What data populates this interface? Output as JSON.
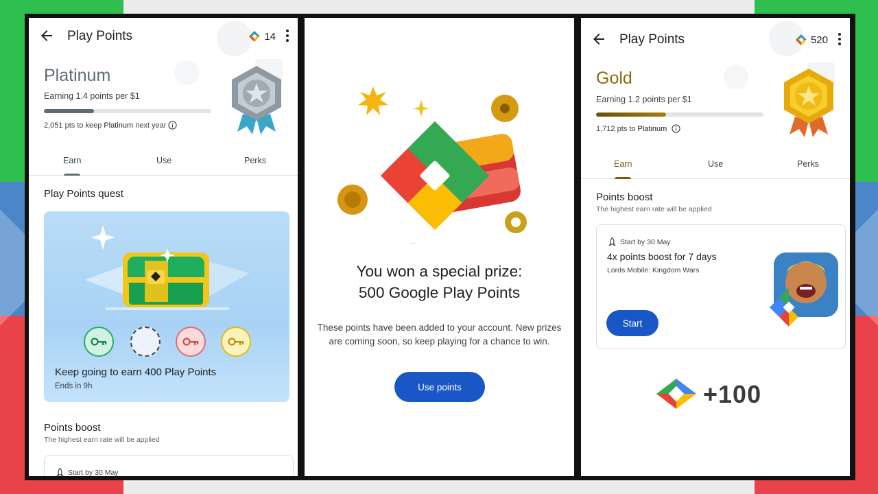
{
  "left": {
    "title": "Play Points",
    "points": "14",
    "tier": "Platinum",
    "earning": "Earning 1.4 points per $1",
    "progress_fraction": 0.3,
    "keep_prefix": "2,051 pts to keep ",
    "keep_tier": "Platinum",
    "keep_suffix": " next year",
    "tabs": [
      "Earn",
      "Use",
      "Perks"
    ],
    "quest_heading": "Play Points quest",
    "quest_text": "Keep going to earn 400 Play Points",
    "quest_ends": "Ends in 9h",
    "boost_heading": "Points boost",
    "boost_sub": "The highest earn rate will be applied",
    "card_start": "Start by 30 May"
  },
  "middle": {
    "line1": "You won a special prize:",
    "line2": "500 Google Play Points",
    "desc": "These points have been added to your account. New prizes are coming soon, so keep playing for a chance to win.",
    "button": "Use points"
  },
  "right": {
    "title": "Play Points",
    "points": "520",
    "tier": "Gold",
    "earning": "Earning 1.2 points per $1",
    "progress_fraction": 0.42,
    "keep_prefix": "1,712 pts to ",
    "keep_tier": "Platinum",
    "tabs": [
      "Earn",
      "Use",
      "Perks"
    ],
    "boost_heading": "Points boost",
    "boost_sub": "The highest earn rate will be applied",
    "card_start": "Start by 30 May",
    "card_title": "4x points boost for 7 days",
    "card_game": "Lords Mobile: Kingdom Wars",
    "card_button": "Start",
    "bonus": "+100"
  },
  "colors": {
    "accent_blue": "#1a57c6",
    "platinum": "#5f6b73",
    "gold": "#8a6a12",
    "gold_tab": "#7a5a08"
  },
  "icons": [
    "back-arrow-icon",
    "play-points-diamond-icon",
    "more-vert-icon",
    "info-icon",
    "rocket-icon",
    "key-icon",
    "treasure-chest",
    "tier-badge"
  ]
}
